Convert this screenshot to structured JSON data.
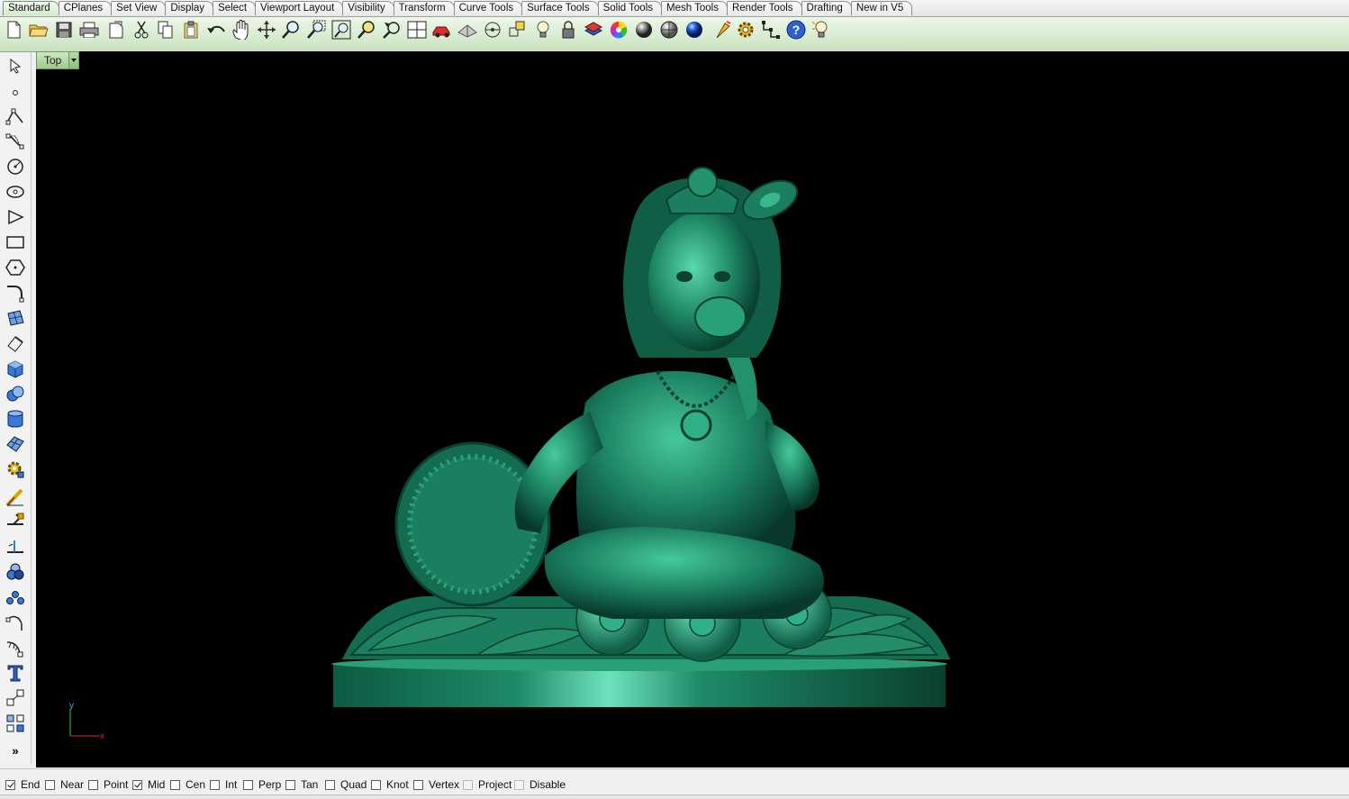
{
  "tabs": [
    "Standard",
    "CPlanes",
    "Set View",
    "Display",
    "Select",
    "Viewport Layout",
    "Visibility",
    "Transform",
    "Curve Tools",
    "Surface Tools",
    "Solid Tools",
    "Mesh Tools",
    "Render Tools",
    "Drafting",
    "New in V5"
  ],
  "active_tab": "Standard",
  "toolbar_icons": [
    "new-document-icon",
    "open-folder-icon",
    "save-icon",
    "print-icon",
    "import-icon",
    "cut-icon",
    "copy-icon",
    "paste-icon",
    "undo-icon",
    "pan-hand-icon",
    "rotate-view-icon",
    "zoom-icon",
    "zoom-window-icon",
    "zoom-extents-icon",
    "zoom-selected-icon",
    "undo-view-icon",
    "four-viewports-icon",
    "named-view-icon",
    "named-cplane-icon",
    "cplane-icon",
    "snap-icon",
    "light-icon",
    "lock-icon",
    "layer-icon",
    "properties-color-icon",
    "wireframe-sphere-icon",
    "shaded-sphere-icon",
    "rendered-sphere-icon",
    "render-icon",
    "options-gear-icon",
    "grid-snap-icon",
    "help-icon",
    "tips-icon"
  ],
  "left_tools": [
    "select-arrow-icon",
    "point-icon",
    "polyline-icon",
    "curve-icon",
    "circle-icon",
    "ellipse-icon",
    "arc-icon",
    "rectangle-icon",
    "polygon-icon",
    "fillet-curve-icon",
    "surface-icon",
    "extrude-icon",
    "box-solid-icon",
    "boolean-union-icon",
    "cylinder-icon",
    "mesh-icon",
    "gear-transform-icon",
    "analyze-icon",
    "split-icon",
    "trim-icon",
    "solid-union-icon",
    "array-icon",
    "rotate-icon",
    "curve-tools-icon",
    "text-icon",
    "scale-icon",
    "group-icon"
  ],
  "left_more_label": "»",
  "viewport": {
    "title": "Top",
    "axis_y": "y",
    "axis_x": "x",
    "model_color": "#1e8a68",
    "background": "#000000"
  },
  "osnaps": [
    {
      "label": "End",
      "checked": true,
      "enabled": true
    },
    {
      "label": "Near",
      "checked": false,
      "enabled": true
    },
    {
      "label": "Point",
      "checked": false,
      "enabled": true
    },
    {
      "label": "Mid",
      "checked": true,
      "enabled": true
    },
    {
      "label": "Cen",
      "checked": false,
      "enabled": true
    },
    {
      "label": "Int",
      "checked": false,
      "enabled": true
    },
    {
      "label": "Perp",
      "checked": false,
      "enabled": true
    },
    {
      "label": "Tan",
      "checked": false,
      "enabled": true
    },
    {
      "label": "Quad",
      "checked": false,
      "enabled": true
    },
    {
      "label": "Knot",
      "checked": false,
      "enabled": true
    },
    {
      "label": "Vertex",
      "checked": false,
      "enabled": true
    },
    {
      "label": "Project",
      "checked": false,
      "enabled": false
    },
    {
      "label": "Disable",
      "checked": false,
      "enabled": false
    }
  ],
  "colors": {
    "tab_active": "#d3ecc9",
    "toolbar_bg": "#d9ecd1",
    "viewport_bg": "#000000",
    "model_green": "#1e8a68"
  }
}
